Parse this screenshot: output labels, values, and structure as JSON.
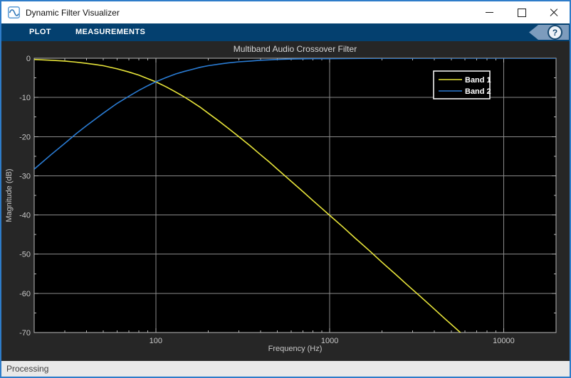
{
  "window": {
    "title": "Dynamic Filter Visualizer"
  },
  "icons": {
    "app": "sine-wave-icon",
    "minimize": "minimize-icon",
    "maximize": "maximize-icon",
    "close": "close-icon",
    "help": "question-mark-icon"
  },
  "toolbar": {
    "tabs": [
      {
        "label": "PLOT"
      },
      {
        "label": "MEASUREMENTS"
      }
    ],
    "help_label": "?"
  },
  "statusbar": {
    "text": "Processing"
  },
  "colors": {
    "accent_blue": "#2e7cc9",
    "toolbar_bg": "#04406f",
    "figure_bg": "#262626",
    "plot_bg": "#000000",
    "axis": "#b8b8b8",
    "grid": "#8a8a8a",
    "tick_label": "#c8c8c8",
    "title": "#d6d6d6",
    "legend_border": "#ffffff",
    "legend_text": "#ffffff"
  },
  "chart_data": {
    "type": "line",
    "title": "Multiband Audio Crossover Filter",
    "xlabel": "Frequency (Hz)",
    "ylabel": "Magnitude (dB)",
    "x_scale": "log",
    "xlim": [
      20,
      20000
    ],
    "ylim": [
      -70,
      0
    ],
    "x_major_ticks": [
      100,
      1000,
      10000
    ],
    "x_major_tick_labels": [
      "100",
      "1000",
      "10000"
    ],
    "y_major_ticks": [
      0,
      -10,
      -20,
      -30,
      -40,
      -50,
      -60,
      -70
    ],
    "y_major_tick_labels": [
      "0",
      "-10",
      "-20",
      "-30",
      "-40",
      "-50",
      "-60",
      "-70"
    ],
    "grid": true,
    "legend_position": "northeast",
    "series": [
      {
        "name": "Band 1",
        "color": "#e8e53a",
        "description": "lowpass band, -6 dB at 100 Hz crossover, ~40 dB/decade rolloff",
        "x": [
          20,
          25,
          30,
          35,
          40,
          45,
          50,
          60,
          70,
          80,
          90,
          100,
          115,
          130,
          145,
          160,
          180,
          200,
          230,
          260,
          300,
          350,
          400,
          450,
          500,
          600,
          700,
          800,
          900,
          1000,
          1200,
          1400,
          1700,
          2000,
          2400,
          2800,
          3300,
          3900,
          4600,
          5200,
          5600,
          6000
        ],
        "y": [
          -0.3,
          -0.5,
          -0.7,
          -1.0,
          -1.3,
          -1.6,
          -1.9,
          -2.7,
          -3.5,
          -4.3,
          -5.2,
          -6.0,
          -7.3,
          -8.6,
          -9.8,
          -11.0,
          -12.5,
          -14.0,
          -16.0,
          -17.8,
          -20.0,
          -22.4,
          -24.6,
          -26.5,
          -28.3,
          -31.4,
          -34.0,
          -36.3,
          -38.3,
          -40.1,
          -43.2,
          -45.9,
          -49.2,
          -52.1,
          -55.2,
          -57.9,
          -60.7,
          -63.6,
          -66.5,
          -68.6,
          -69.9,
          -71.1
        ]
      },
      {
        "name": "Band 2",
        "color": "#2a7cd4",
        "description": "highpass band, -28 dB at 20 Hz, -6 dB at 100 Hz crossover, ~0 dB above 500 Hz",
        "x": [
          20,
          25,
          30,
          35,
          40,
          45,
          50,
          60,
          70,
          80,
          90,
          100,
          115,
          130,
          145,
          160,
          180,
          200,
          230,
          260,
          300,
          350,
          400,
          500,
          600,
          800,
          1000,
          1500,
          2000,
          3000,
          5000,
          10000,
          20000
        ],
        "y": [
          -28.3,
          -24.6,
          -21.7,
          -19.2,
          -17.2,
          -15.5,
          -14.0,
          -11.5,
          -9.7,
          -8.2,
          -7.0,
          -6.0,
          -4.9,
          -4.0,
          -3.4,
          -2.9,
          -2.3,
          -1.9,
          -1.5,
          -1.2,
          -0.9,
          -0.7,
          -0.5,
          -0.3,
          -0.2,
          -0.1,
          -0.1,
          -0.04,
          -0.02,
          -0.01,
          0,
          0,
          0
        ]
      }
    ]
  }
}
